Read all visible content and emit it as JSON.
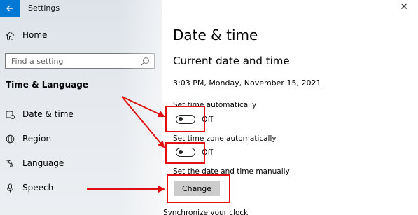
{
  "window": {
    "title": "Settings",
    "close_glyph": "✕"
  },
  "sidebar": {
    "home_label": "Home",
    "search_placeholder": "Find a setting",
    "section_title": "Time & Language",
    "items": [
      {
        "label": "Date & time",
        "icon": "date-time-icon"
      },
      {
        "label": "Region",
        "icon": "globe-icon"
      },
      {
        "label": "Language",
        "icon": "language-icon"
      },
      {
        "label": "Speech",
        "icon": "microphone-icon"
      }
    ]
  },
  "main": {
    "page_title": "Date & time",
    "section_title": "Current date and time",
    "current_datetime": "3:03 PM, Monday, November 15, 2021",
    "set_time_auto": {
      "label": "Set time automatically",
      "state": "Off"
    },
    "set_timezone_auto": {
      "label": "Set time zone automatically",
      "state": "Off"
    },
    "manual": {
      "label": "Set the date and time manually",
      "button": "Change"
    },
    "sync_label": "Synchronize your clock"
  },
  "colors": {
    "accent": "#0078d4",
    "annotation": "#e01010"
  }
}
